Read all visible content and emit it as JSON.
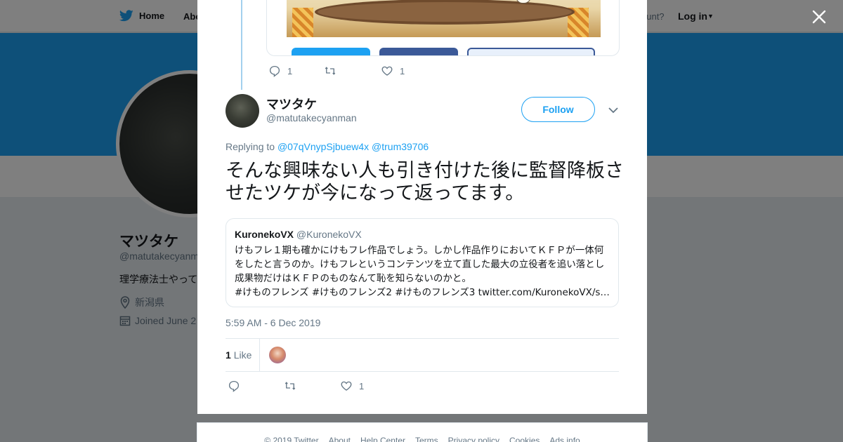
{
  "nav": {
    "home_label": "Home",
    "about_label": "Abo",
    "account_prompt": "ccount?",
    "login_label": "Log in"
  },
  "profile": {
    "name": "マツタケ",
    "handle": "@matutakecyanm",
    "bio": "理学療法士やって",
    "location": "新潟県",
    "joined": "Joined June 2"
  },
  "previous_tweet": {
    "reply_count": "1",
    "retweet_count": "",
    "like_count": "1",
    "share_buttons": [
      "twitter-share",
      "facebook-share",
      "bookmark-share"
    ]
  },
  "tweet": {
    "author_name": "マツタケ",
    "author_handle": "@matutakecyanman",
    "follow_label": "Follow",
    "replying_prefix": "Replying to",
    "replying_to": [
      "@07qVnypSjbuew4x",
      "@trum39706"
    ],
    "text": "そんな興味ない人も引き付けた後に監督降板させたツケが今になって返ってます。",
    "timestamp": "5:59 AM - 6 Dec 2019",
    "like_count": "1",
    "like_label": "Like",
    "action_like_count": "1"
  },
  "quote": {
    "name": "KuronekoVX",
    "handle": "@KuronekoVX",
    "text": "けもフレ１期も確かにけもフレ作品でしょう。しかし作品作りにおいてＫＦＰが一体何をしたと言うのか。けもフレというコンテンツを立て直した最大の立役者を追い落とし成果物だけはＫＦＰのものなんて恥を知らないのかと。",
    "tags": "#けものフレンズ #けものフレンズ2 #けものフレンズ3 twitter.com/KuronekoVX/sta…"
  },
  "footer": {
    "links": [
      "© 2019 Twitter",
      "About",
      "Help Center",
      "Terms",
      "Privacy policy",
      "Cookies",
      "Ads info"
    ]
  },
  "colors": {
    "accent": "#1da1f2",
    "text": "#14171a",
    "muted": "#657786",
    "border": "#e1e8ed"
  }
}
